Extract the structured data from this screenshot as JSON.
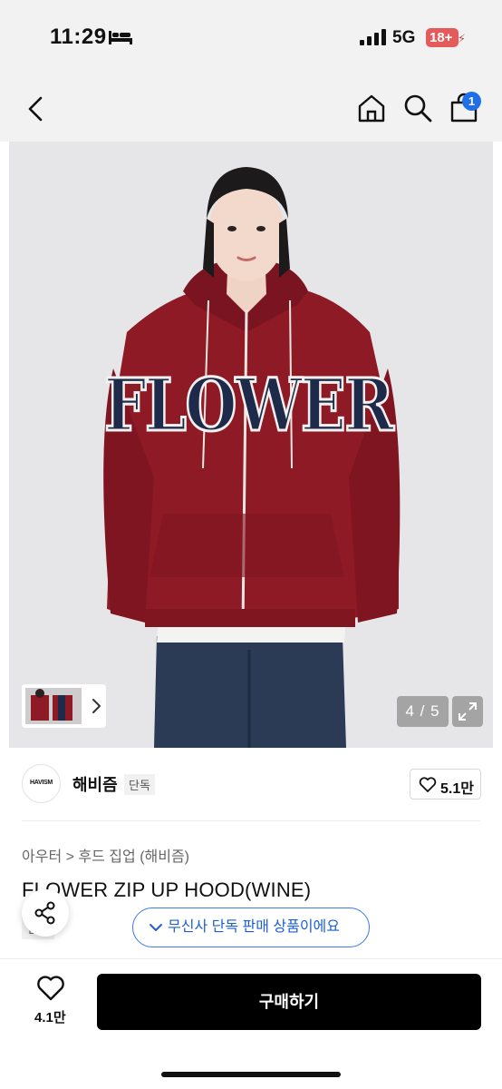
{
  "status_bar": {
    "time": "11:29",
    "network": "5G",
    "age_rating": "18+"
  },
  "nav": {
    "cart_count": "1"
  },
  "gallery": {
    "counter": "4 / 5",
    "garment_print": "FLOWER",
    "garment_color": "#8e1a26"
  },
  "brand": {
    "logo_text": "HAVISM",
    "name": "해비즘",
    "tag": "단독",
    "likes": "5.1만"
  },
  "product": {
    "breadcrumb": [
      "아우터",
      ">",
      "후드 집업 (해비즘)"
    ],
    "title": "FLOWER ZIP UP HOOD(WINE)",
    "tag": "단독",
    "exclusive_notice": "무신사 단독 판매 상품이에요"
  },
  "bottom_bar": {
    "wish_count": "4.1만",
    "buy_label": "구매하기"
  },
  "colors": {
    "accent_blue": "#1f6fe8",
    "buy_button": "#000000",
    "age_badge": "#e35b5b"
  }
}
